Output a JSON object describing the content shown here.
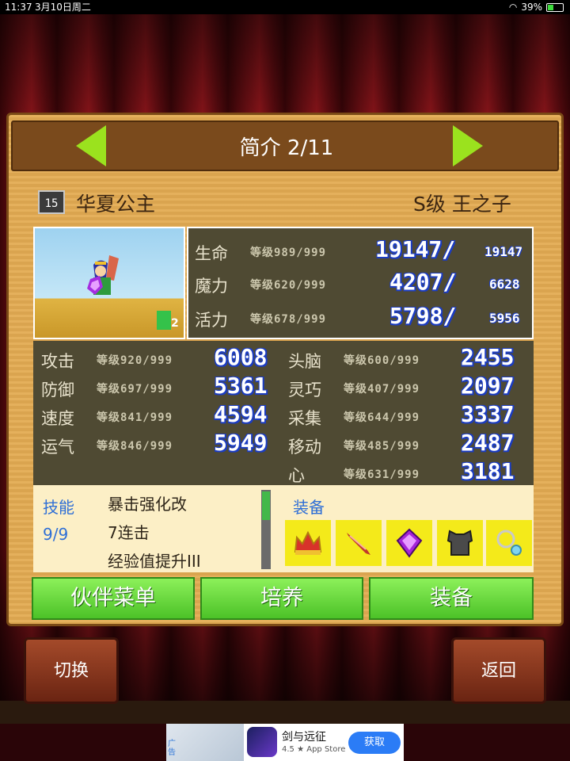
{
  "status_bar": {
    "time": "11:37",
    "date": "3月10日周二",
    "battery": "39%"
  },
  "header": {
    "title": "简介 2/11"
  },
  "character": {
    "level_badge": "15",
    "name": "华夏公主",
    "rank": "S级 王之子",
    "companion_count": "2"
  },
  "vitals": [
    {
      "label": "生命",
      "level": "等级989/999",
      "current": "19147/",
      "max": "19147"
    },
    {
      "label": "魔力",
      "level": "等级620/999",
      "current": "4207/",
      "max": "6628"
    },
    {
      "label": "活力",
      "level": "等级678/999",
      "current": "5798/",
      "max": "5956"
    }
  ],
  "stats_left": [
    {
      "label": "攻击",
      "level": "等级920/999",
      "value": "6008"
    },
    {
      "label": "防御",
      "level": "等级697/999",
      "value": "5361"
    },
    {
      "label": "速度",
      "level": "等级841/999",
      "value": "4594"
    },
    {
      "label": "运气",
      "level": "等级846/999",
      "value": "5949"
    }
  ],
  "stats_right": [
    {
      "label": "头脑",
      "level": "等级600/999",
      "value": "2455"
    },
    {
      "label": "灵巧",
      "level": "等级407/999",
      "value": "2097"
    },
    {
      "label": "采集",
      "level": "等级644/999",
      "value": "3337"
    },
    {
      "label": "移动",
      "level": "等级485/999",
      "value": "2487"
    },
    {
      "label": "心",
      "level": "等级631/999",
      "value": "3181"
    }
  ],
  "skills": {
    "title": "技能",
    "count": "9/9",
    "items": [
      "暴击强化改",
      "7连击",
      "经验值提升III"
    ]
  },
  "equipment": {
    "title": "装备",
    "icons": [
      "crown-icon",
      "sword-icon",
      "gem-icon",
      "armor-icon",
      "necklace-icon"
    ]
  },
  "buttons": {
    "partner_menu": "伙伴菜单",
    "train": "培养",
    "equip": "装备",
    "switch": "切换",
    "back": "返回"
  },
  "ad": {
    "tag": "广告",
    "title": "剑与远征",
    "rating": "4.5 ★ App Store",
    "cta": "获取"
  },
  "colors": {
    "panel": "#e3ab52",
    "stat_bg": "#4f4a33",
    "accent_green": "#4cc228",
    "number_blue": "#1b3cc2"
  }
}
